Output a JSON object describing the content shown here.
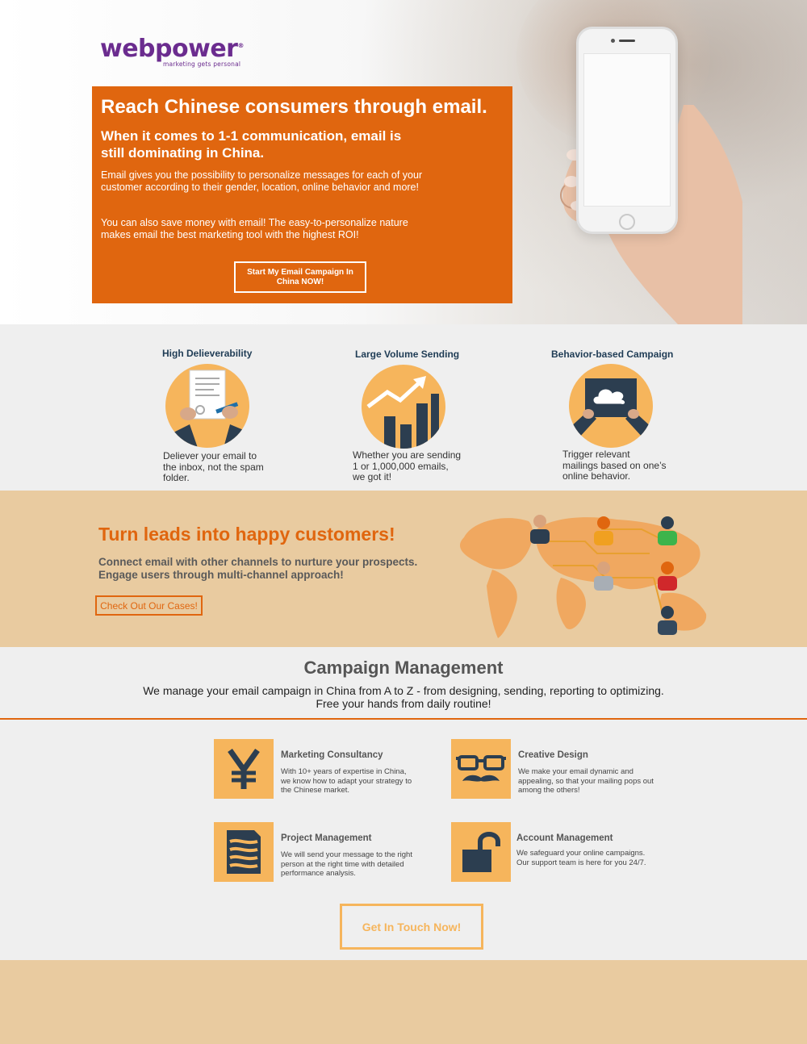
{
  "brand": {
    "logo_text": "webpower",
    "tagline": "marketing gets personal",
    "color": "#6b2c8f",
    "accent": "#e0660f"
  },
  "hero": {
    "title": "Reach Chinese consumers through email.",
    "subtitle": "When it comes to 1-1 communication, email is still dominating in China.",
    "paragraph1": "Email gives you the possibility to personalize messages for each of your customer according to their gender, location, online behavior and more!",
    "paragraph2": "You can also save money with email! The easy-to-personalize nature makes email the best marketing tool with the highest ROI!",
    "cta_label": "Start My Email Campaign In China NOW!"
  },
  "features": [
    {
      "title": "High Delieverability",
      "text": "Deliever your email to the inbox, not the spam folder.",
      "icon": "document-sign-icon"
    },
    {
      "title": "Large Volume Sending",
      "text": "Whether you are sending 1 or 1,000,000 emails, we got it!",
      "icon": "growth-chart-icon"
    },
    {
      "title": "Behavior-based Campaign",
      "text": "Trigger relevant mailings based on one’s online behavior.",
      "icon": "cloud-tablet-icon"
    }
  ],
  "leads": {
    "title": "Turn leads into happy customers!",
    "line1": "Connect email with other channels to nurture your prospects.",
    "line2": "Engage users through multi-channel approach!",
    "cta_label": "Check Out Our Cases!",
    "illustration": "world-map-people-icon"
  },
  "campaign": {
    "title": "Campaign Management",
    "line1": "We manage your email campaign in China from A to Z - from designing, sending, reporting to optimizing.",
    "line2": "Free your hands from daily routine!"
  },
  "services": [
    {
      "title": "Marketing Consultancy",
      "text": "With 10+ years of expertise in China, we know how to adapt your strategy to the Chinese market.",
      "icon": "yen-icon"
    },
    {
      "title": "Creative Design",
      "text": "We make your email dynamic and appealing, so that your mailing pops out among the others!",
      "icon": "glasses-mustache-icon"
    },
    {
      "title": "Project Management",
      "text": "We will send your message to the right person at the right time with detailed performance analysis.",
      "icon": "document-lines-icon"
    },
    {
      "title": "Account Management",
      "text": "We safeguard your online campaigns. Our support team is here for you 24/7.",
      "icon": "unlocked-padlock-icon"
    }
  ],
  "contact": {
    "cta_label": "Get In Touch Now!"
  }
}
